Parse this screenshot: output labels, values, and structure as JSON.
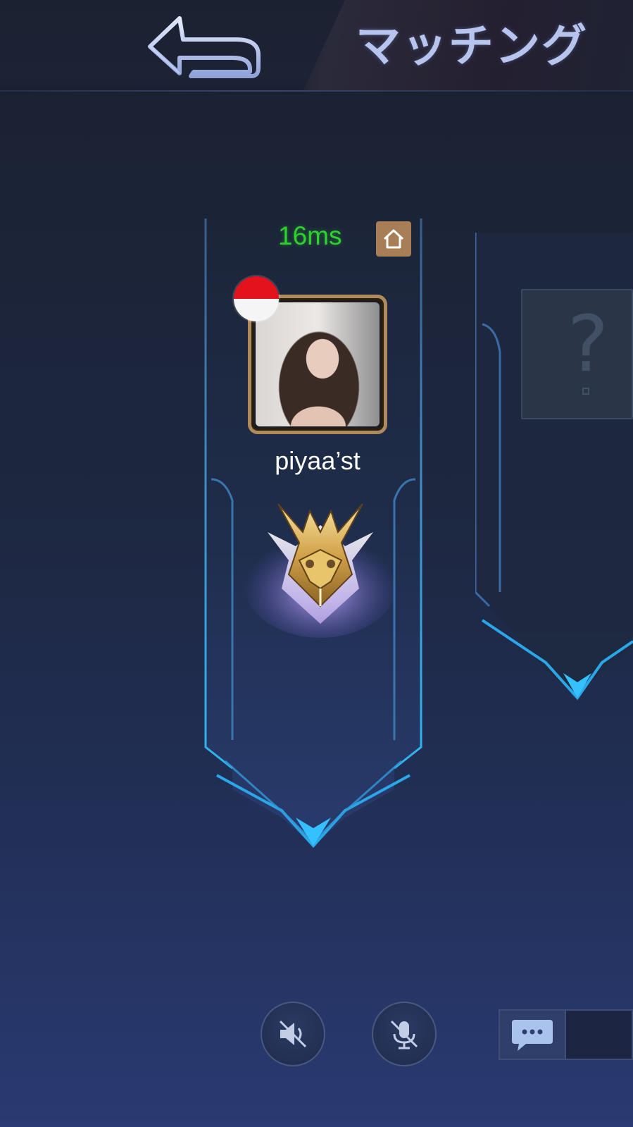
{
  "header": {
    "title": "マッチング",
    "back_icon": "back-arrow-icon"
  },
  "player": {
    "ping": "16ms",
    "ping_color": "#2fd12f",
    "home_icon": "home-icon",
    "flag_icon": "indonesia-flag-icon",
    "name": "piyaa’st",
    "rank_icon": "mythic-rank-emblem-icon"
  },
  "other_slot": {
    "placeholder_glyph": "?"
  },
  "controls": {
    "speaker_icon": "speaker-muted-icon",
    "mic_icon": "mic-muted-icon",
    "chat_icon": "chat-bubble-icon"
  },
  "colors": {
    "accent_cyan": "#2aa7e8",
    "avatar_frame": "#b18a5c",
    "home_badge": "#a77e55"
  }
}
